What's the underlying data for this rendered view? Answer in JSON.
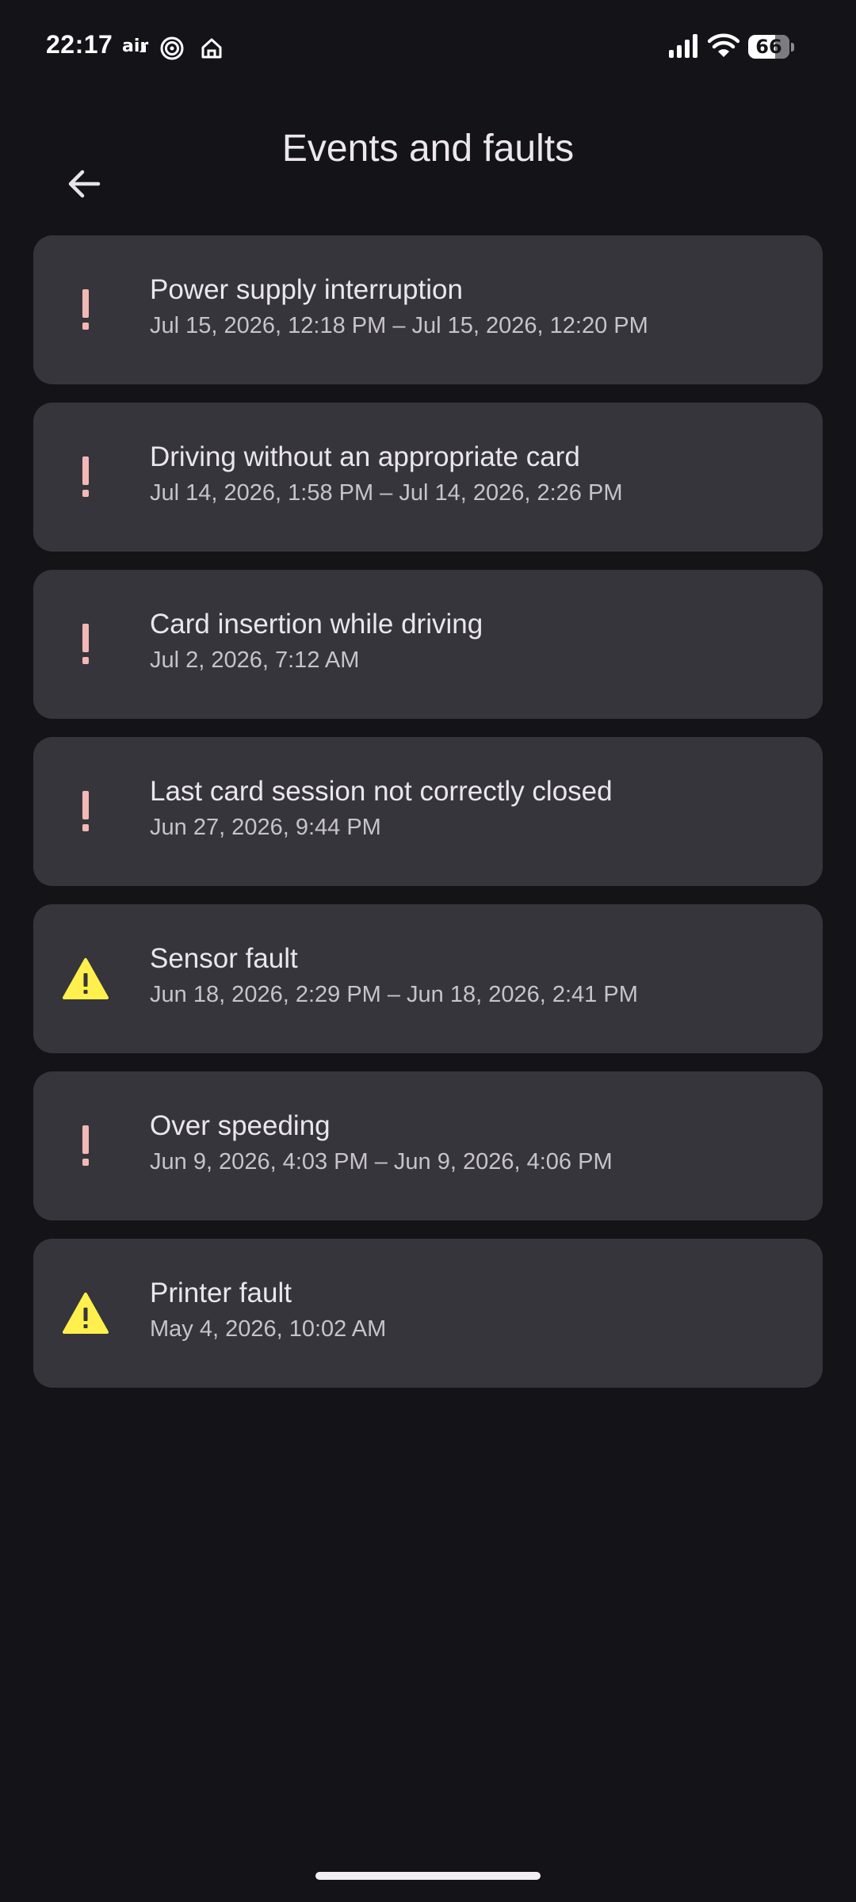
{
  "status_bar": {
    "time": "22:17",
    "air_label": "air",
    "battery_level": "66",
    "battery_fraction": 0.66,
    "icons": [
      "air-icon",
      "spiral-icon",
      "home-icon",
      "cellular-signal-icon",
      "wifi-icon",
      "battery-icon"
    ]
  },
  "app_bar": {
    "title": "Events and faults",
    "back_icon": "arrow-back-icon"
  },
  "colors": {
    "background": "#141318",
    "card": "#36353b",
    "event_icon": "#f2b8b5",
    "fault_icon": "#fff04d"
  },
  "events": [
    {
      "type": "event",
      "icon": "exclamation-icon",
      "title": "Power supply interruption",
      "time": "Jul 15, 2026, 12:18 PM – Jul 15, 2026, 12:20 PM"
    },
    {
      "type": "event",
      "icon": "exclamation-icon",
      "title": "Driving without an appropriate card",
      "time": "Jul 14, 2026, 1:58 PM – Jul 14, 2026, 2:26 PM"
    },
    {
      "type": "event",
      "icon": "exclamation-icon",
      "title": "Card insertion while driving",
      "time": "Jul 2, 2026, 7:12 AM"
    },
    {
      "type": "event",
      "icon": "exclamation-icon",
      "title": "Last card session not correctly closed",
      "time": "Jun 27, 2026, 9:44 PM"
    },
    {
      "type": "fault",
      "icon": "warning-triangle-icon",
      "title": "Sensor fault",
      "time": "Jun 18, 2026, 2:29 PM – Jun 18, 2026, 2:41 PM"
    },
    {
      "type": "event",
      "icon": "exclamation-icon",
      "title": "Over speeding",
      "time": "Jun 9, 2026, 4:03 PM – Jun 9, 2026, 4:06 PM"
    },
    {
      "type": "fault",
      "icon": "warning-triangle-icon",
      "title": "Printer fault",
      "time": "May 4, 2026, 10:02 AM"
    }
  ]
}
